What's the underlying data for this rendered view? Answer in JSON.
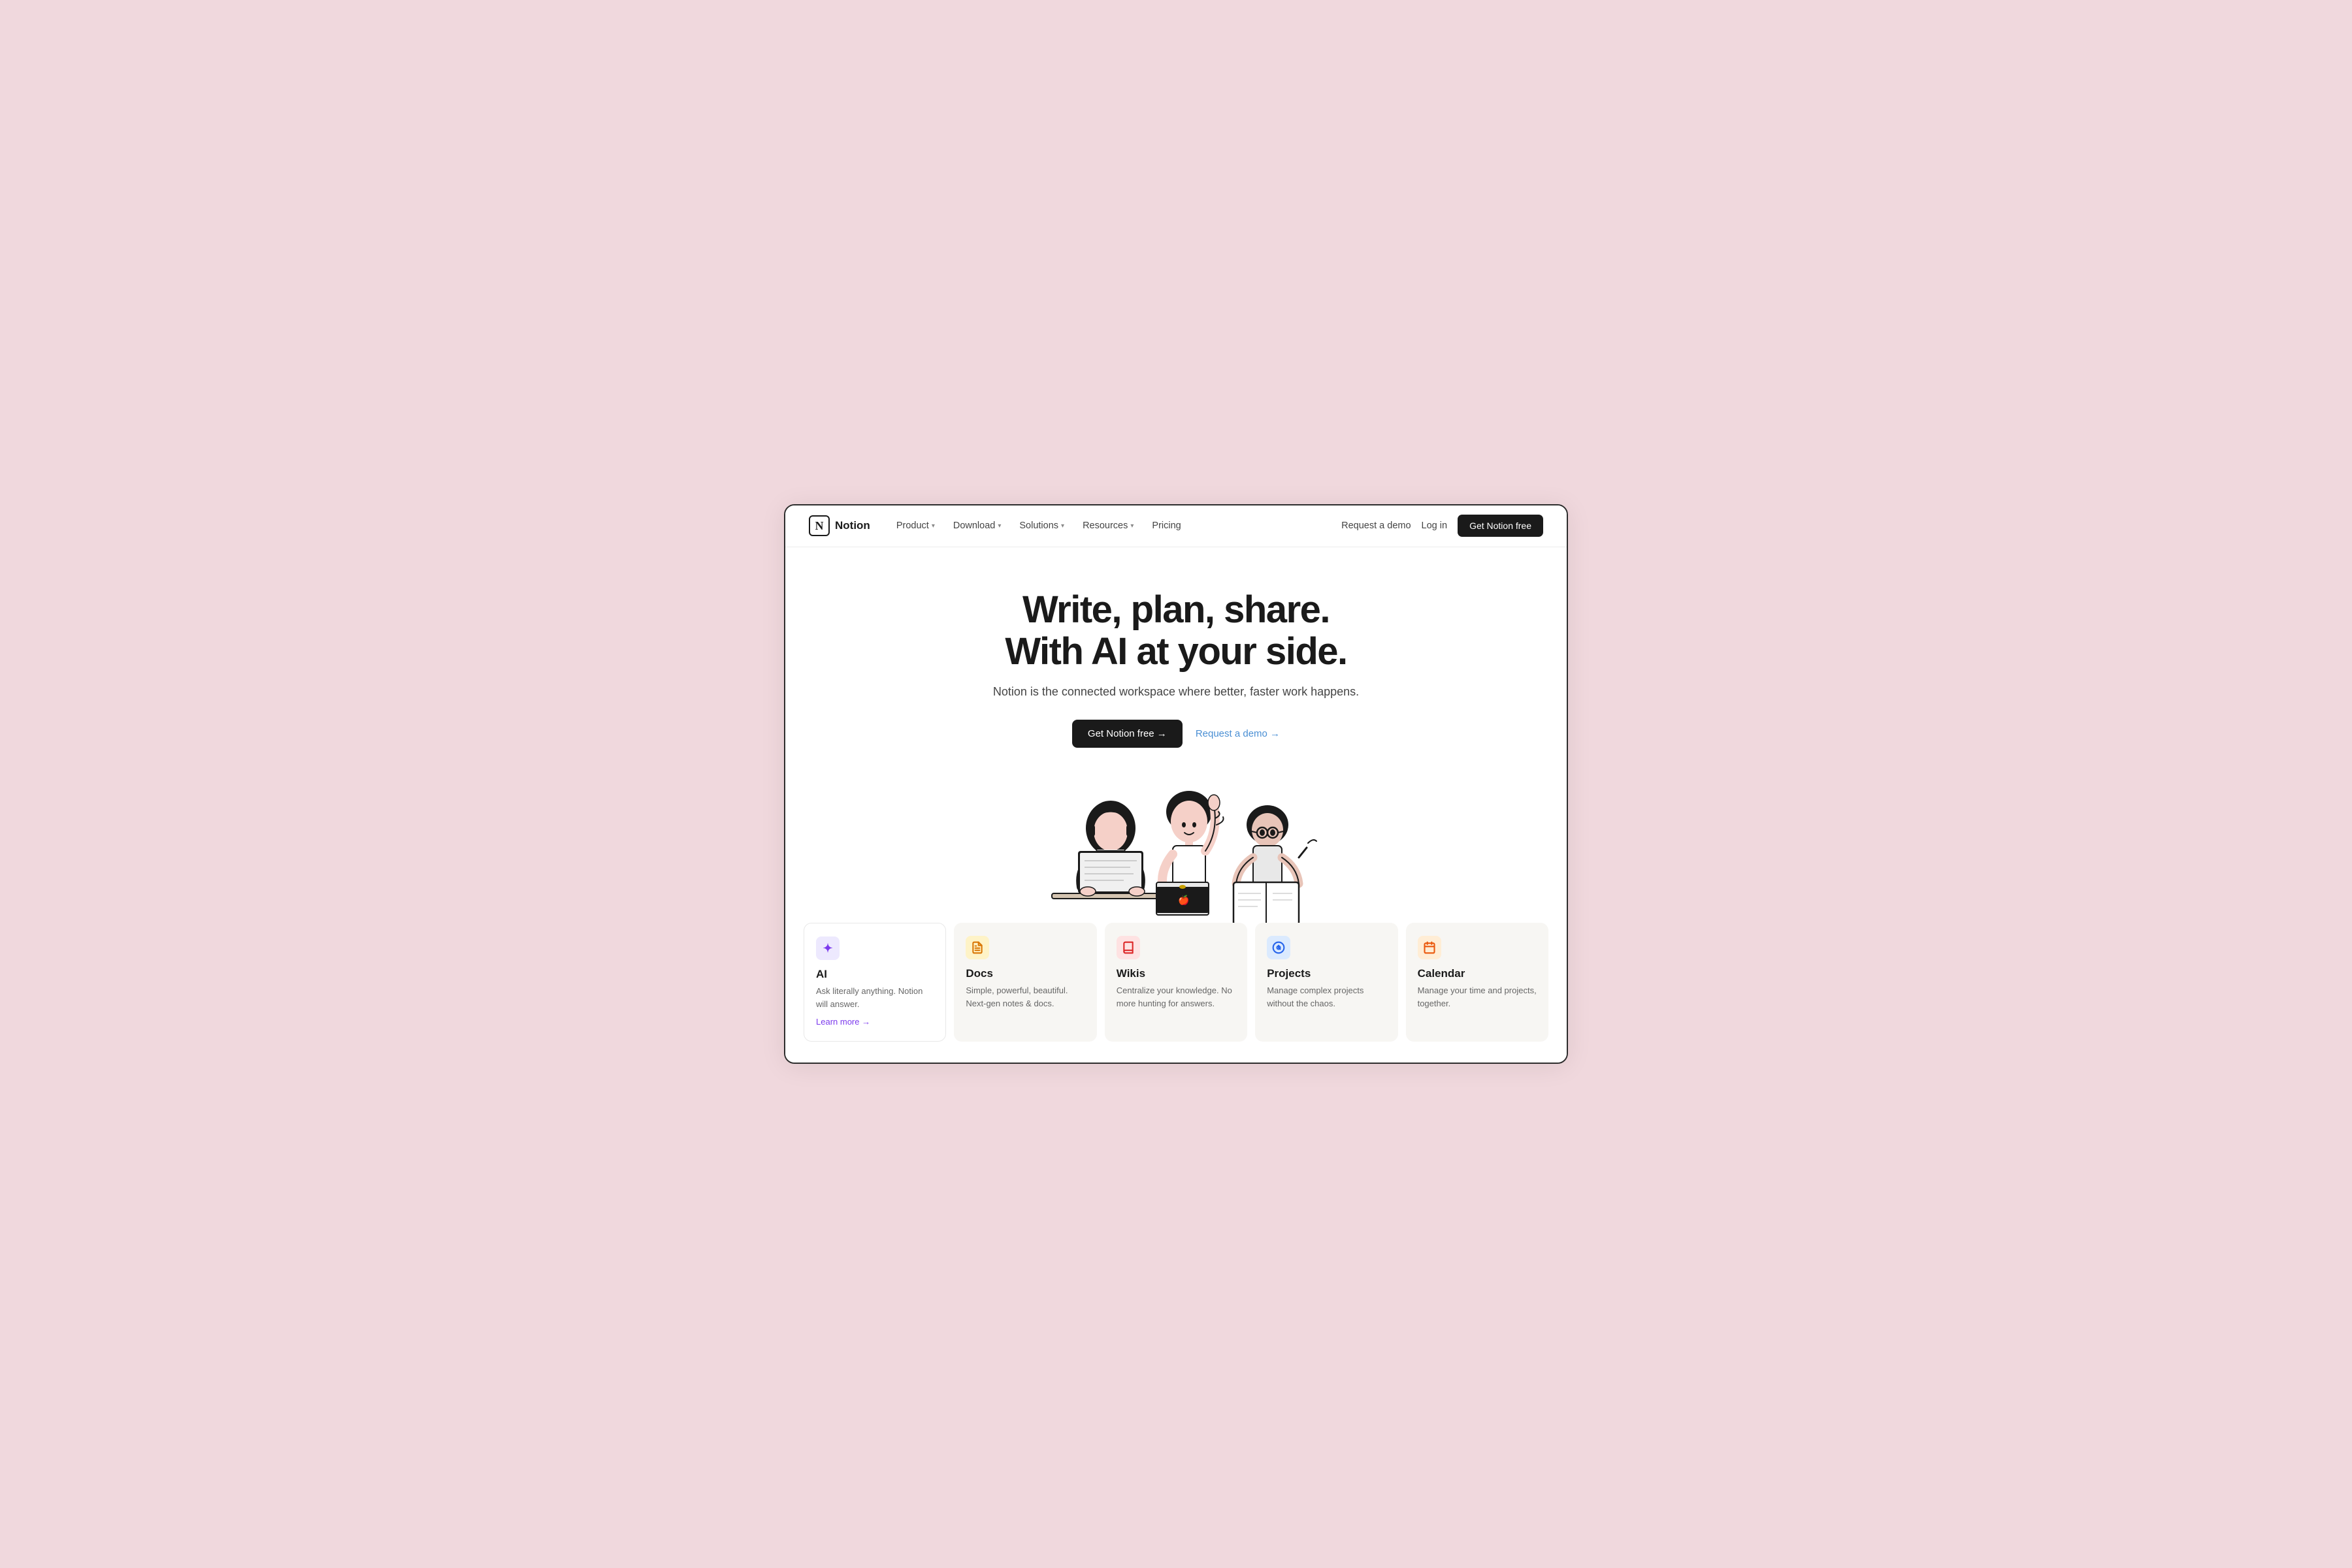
{
  "page": {
    "bg_color": "#f0d8dd"
  },
  "nav": {
    "logo_letter": "N",
    "logo_text": "Notion",
    "links": [
      {
        "label": "Product",
        "has_chevron": true
      },
      {
        "label": "Download",
        "has_chevron": true
      },
      {
        "label": "Solutions",
        "has_chevron": true
      },
      {
        "label": "Resources",
        "has_chevron": true
      },
      {
        "label": "Pricing",
        "has_chevron": false
      }
    ],
    "right_links": [
      {
        "label": "Request a demo"
      },
      {
        "label": "Log in"
      }
    ],
    "cta_label": "Get Notion free"
  },
  "hero": {
    "title_line1": "Write, plan, share.",
    "title_line2": "With AI at your side.",
    "subtitle": "Notion is the connected workspace where better, faster work happens.",
    "cta_primary": "Get Notion free →",
    "cta_secondary": "Request a demo →"
  },
  "features": [
    {
      "id": "ai",
      "icon_class": "icon-ai",
      "icon_symbol": "✦",
      "title": "AI",
      "desc": "Ask literally anything. Notion will answer.",
      "learn_more": "Learn more →",
      "active": true
    },
    {
      "id": "docs",
      "icon_class": "icon-docs",
      "icon_symbol": "📄",
      "title": "Docs",
      "desc": "Simple, powerful, beautiful. Next-gen notes & docs.",
      "learn_more": "",
      "active": false
    },
    {
      "id": "wikis",
      "icon_class": "icon-wikis",
      "icon_symbol": "📚",
      "title": "Wikis",
      "desc": "Centralize your knowledge. No more hunting for answers.",
      "learn_more": "",
      "active": false
    },
    {
      "id": "projects",
      "icon_class": "icon-projects",
      "icon_symbol": "🎯",
      "title": "Projects",
      "desc": "Manage complex projects without the chaos.",
      "learn_more": "",
      "active": false
    },
    {
      "id": "calendar",
      "icon_class": "icon-calendar",
      "icon_symbol": "📅",
      "title": "Calendar",
      "desc": "Manage your time and projects, together.",
      "learn_more": "",
      "active": false
    }
  ]
}
